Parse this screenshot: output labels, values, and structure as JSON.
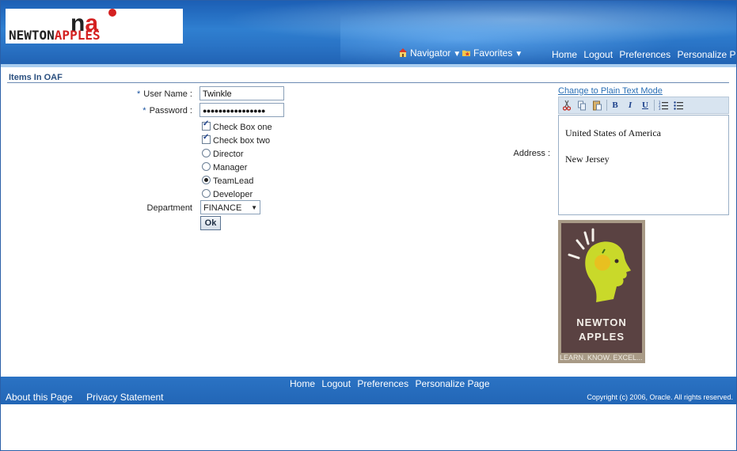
{
  "brand": {
    "logo_na_n": "n",
    "logo_na_a": "a",
    "logo_word1": "NEWTON",
    "logo_word2": "APPLES"
  },
  "global_nav": {
    "navigator_label": "Navigator",
    "favorites_label": "Favorites",
    "links": [
      "Home",
      "Logout",
      "Preferences",
      "Personalize Page"
    ]
  },
  "region": {
    "title": "Items In OAF"
  },
  "form": {
    "username_label": "User Name :",
    "username_value": "Twinkle",
    "password_label": "Password :",
    "password_value": "●●●●●●●●●●●●●●●●",
    "required_mark": "*",
    "checkboxes": [
      {
        "label": "Check Box one",
        "checked": true
      },
      {
        "label": "Check box two",
        "checked": true
      }
    ],
    "radios": [
      {
        "label": "Director",
        "selected": false
      },
      {
        "label": "Manager",
        "selected": false
      },
      {
        "label": "TeamLead",
        "selected": true
      },
      {
        "label": "Developer",
        "selected": false
      }
    ],
    "department_label": "Department",
    "department_value": "FINANCE",
    "ok_label": "Ok"
  },
  "address": {
    "label": "Address :",
    "plain_text_link": "Change to Plain Text Mode",
    "line1": "United States of America",
    "line2": "New Jersey",
    "toolbar": {
      "bold": "B",
      "italic": "I",
      "underline": "U"
    }
  },
  "promo_image": {
    "title1": "NEWTON",
    "title2": "APPLES",
    "tagline": "LEARN. KNOW. EXCEL..."
  },
  "footer": {
    "links": [
      "Home",
      "Logout",
      "Preferences",
      "Personalize Page"
    ],
    "about": "About this Page",
    "privacy": "Privacy Statement",
    "copyright": "Copyright (c) 2006, Oracle. All rights reserved."
  },
  "colors": {
    "header_blue": "#2a74c6",
    "footer_blue": "#2266b6",
    "link_blue": "#2a6fb5",
    "logo_red": "#d42020"
  }
}
